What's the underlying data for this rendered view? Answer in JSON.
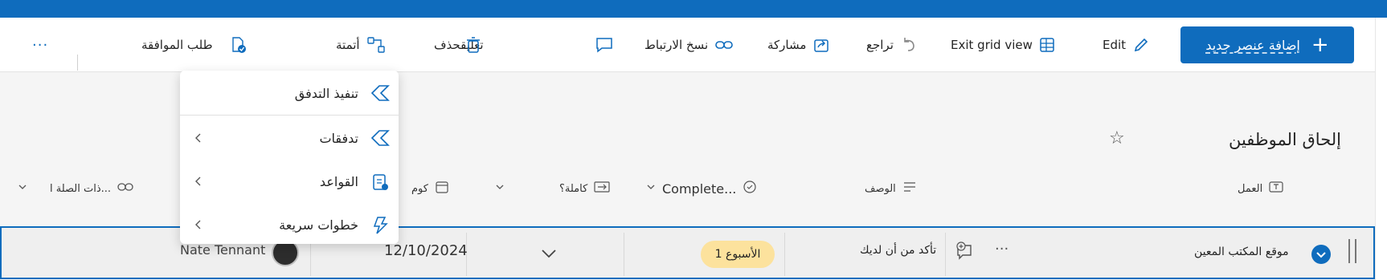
{
  "colors": {
    "brand": "#0f6cbd",
    "badge_bg": "#fce29d",
    "row_bg": "#efefef"
  },
  "toolbar": {
    "new_item_label": "إضافة عنصر جديد",
    "edit_label": "Edit",
    "exit_grid_label": "Exit grid view",
    "undo_label": "تراجع",
    "share_label": "مشاركة",
    "copy_link_label": "نسخ الارتباط",
    "comment_delete_label": "تعليقحذف",
    "automate_label": "أتمتة",
    "request_approval_label": "طلب الموافقة",
    "more_label": "···"
  },
  "list": {
    "title": "إلحاق الموظفين",
    "columns": [
      {
        "label": "العمل",
        "icon": "text-icon"
      },
      {
        "label": "الوصف",
        "icon": "lines-icon"
      },
      {
        "label": "Complete...",
        "icon": "circle-check-icon"
      },
      {
        "label": "كاملة؟",
        "icon": "yes-no-icon"
      },
      {
        "label": "كوم",
        "icon": "calendar-icon"
      },
      {
        "label": "ذات الصلة ا...",
        "icon": "link-icon"
      }
    ],
    "row": {
      "task": "موقع المكتب المعين",
      "description": "تأكد من أن لديك",
      "badge": "الأسبوع 1",
      "date": "12/10/2024",
      "person": "Nate Tennant",
      "more": "···"
    }
  },
  "menu": {
    "items": [
      {
        "label": "تنفيذ التدفق",
        "icon": "flow-icon",
        "has_submenu": false
      },
      {
        "label": "تدفقات",
        "icon": "flow-icon",
        "has_submenu": true
      },
      {
        "label": "القواعد",
        "icon": "rules-icon",
        "has_submenu": true
      },
      {
        "label": "خطوات سريعة",
        "icon": "quick-steps-icon",
        "has_submenu": true
      }
    ]
  }
}
